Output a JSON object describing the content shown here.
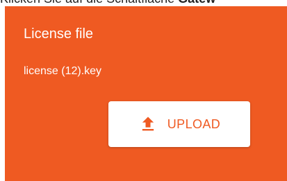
{
  "caption": {
    "prefix": "Klicken Sie auf die Schaltfläche",
    "bold": "Gatew"
  },
  "panel": {
    "title": "License file",
    "filename": "license (12).key",
    "upload_label": "UPLOAD",
    "upload_icon": "upload-icon"
  },
  "colors": {
    "accent": "#ef5a22",
    "text_on_accent": "#ffffff",
    "button_bg": "#ffffff"
  }
}
